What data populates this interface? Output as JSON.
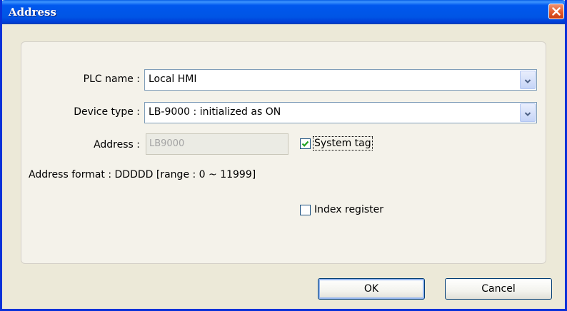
{
  "window": {
    "title": "Address"
  },
  "form": {
    "plc_name_label": "PLC name :",
    "plc_name_value": "Local HMI",
    "device_type_label": "Device type :",
    "device_type_value": "LB-9000 : initialized as ON",
    "address_label": "Address :",
    "address_value": "LB9000",
    "system_tag_label": "System tag",
    "system_tag_checked": true,
    "address_format_text": "Address format : DDDDD [range : 0 ~ 11999]",
    "index_register_label": "Index register",
    "index_register_checked": false
  },
  "buttons": {
    "ok_label": "OK",
    "cancel_label": "Cancel"
  },
  "icons": {
    "close": "close-icon",
    "dropdown": "chevron-down-icon",
    "check": "checkmark-icon"
  },
  "colors": {
    "titlebar": "#0055e5",
    "close_button": "#e35a2b",
    "dialog_background": "#ece9d8",
    "checkmark": "#21a121"
  }
}
